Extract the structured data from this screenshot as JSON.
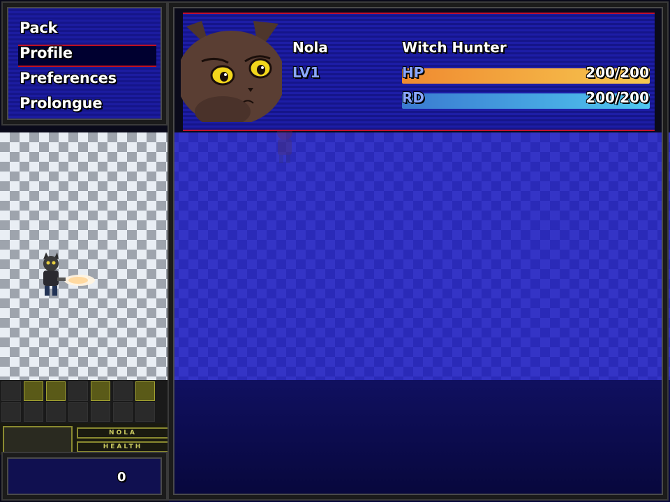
{
  "menu": {
    "items": [
      "Pack",
      "Profile",
      "Preferences",
      "Prolongue"
    ],
    "selected_index": 1
  },
  "character": {
    "name": "Nola",
    "class": "Witch Hunter",
    "level": "LV1",
    "hp_label": "HP",
    "hp_value": "200/200",
    "hp_fill": 1.0,
    "rd_label": "RD",
    "rd_value": "200/200",
    "rd_fill": 1.0
  },
  "hud": {
    "name_label": "NOLA",
    "health_label": "HEALTH",
    "counter": "0"
  },
  "colors": {
    "hp_bar": "#f0a040",
    "rd_bar": "#40a8e0",
    "menu_highlight": "#c01020",
    "panel_blue": "#1c1ca0"
  },
  "icons": {
    "portrait": "cat-portrait-icon",
    "player": "player-sprite-icon"
  }
}
